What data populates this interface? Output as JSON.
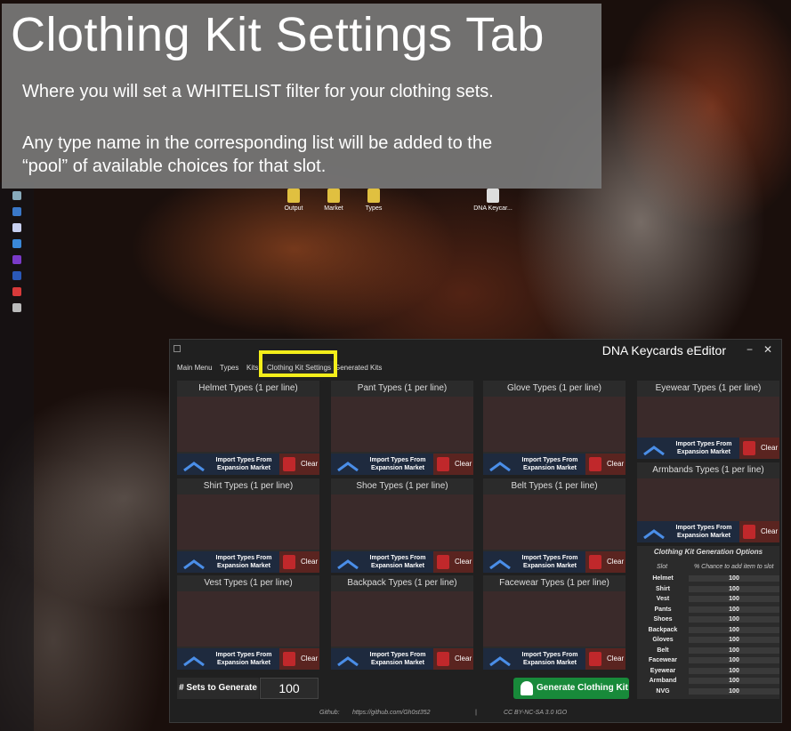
{
  "overlay": {
    "title": "Clothing Kit Settings Tab",
    "line1": "Where you will set a WHITELIST filter for your clothing sets.",
    "line2": "Any type name in the corresponding list will be added to the",
    "line3": "“pool” of available choices for that slot."
  },
  "desktop_icons": [
    "Output",
    "Market",
    "Types",
    "DNA Keycar..."
  ],
  "window": {
    "title": "DNA Keycards eEditor",
    "minimize": "−",
    "close": "✕"
  },
  "tabs": [
    "Main Menu",
    "Types",
    "Kits",
    "Clothing Kit Settings",
    "Generated Kits"
  ],
  "active_tab": "Clothing Kit Settings",
  "panels": {
    "helmet": "Helmet Types (1 per line)",
    "pant": "Pant Types (1 per line)",
    "glove": "Glove Types (1 per line)",
    "eyewear": "Eyewear Types (1 per line)",
    "armbands": "Armbands Types (1 per line)",
    "shirt": "Shirt Types (1 per line)",
    "shoe": "Shoe Types (1 per line)",
    "belt": "Belt Types (1 per line)",
    "vest": "Vest Types (1 per line)",
    "backpack": "Backpack Types (1 per line)",
    "facewear": "Facewear Types (1 per line)"
  },
  "import_label": "Import Types From Expansion Market",
  "clear_label": "Clear",
  "sets": {
    "label": "# Sets to Generate",
    "value": "100"
  },
  "generate_label": "Generate Clothing Kit",
  "options": {
    "title": "Clothing Kit Generation Options",
    "col_slot": "Slot",
    "col_pct": "% Chance to add item to slot",
    "rows": [
      {
        "slot": "Helmet",
        "pct": "100"
      },
      {
        "slot": "Shirt",
        "pct": "100"
      },
      {
        "slot": "Vest",
        "pct": "100"
      },
      {
        "slot": "Pants",
        "pct": "100"
      },
      {
        "slot": "Shoes",
        "pct": "100"
      },
      {
        "slot": "Backpack",
        "pct": "100"
      },
      {
        "slot": "Gloves",
        "pct": "100"
      },
      {
        "slot": "Belt",
        "pct": "100"
      },
      {
        "slot": "Facewear",
        "pct": "100"
      },
      {
        "slot": "Eyewear",
        "pct": "100"
      },
      {
        "slot": "Armband",
        "pct": "100"
      },
      {
        "slot": "NVG",
        "pct": "100"
      }
    ]
  },
  "footer": {
    "github_label": "Github:",
    "github_url": "https://github.com/Gh0st352",
    "divider": "|",
    "license": "CC BY-NC-SA 3.0 IGO"
  },
  "colors": {
    "highlight": "#f4ee1a",
    "generate": "#188a3a",
    "clear_icon": "#c0282b"
  }
}
